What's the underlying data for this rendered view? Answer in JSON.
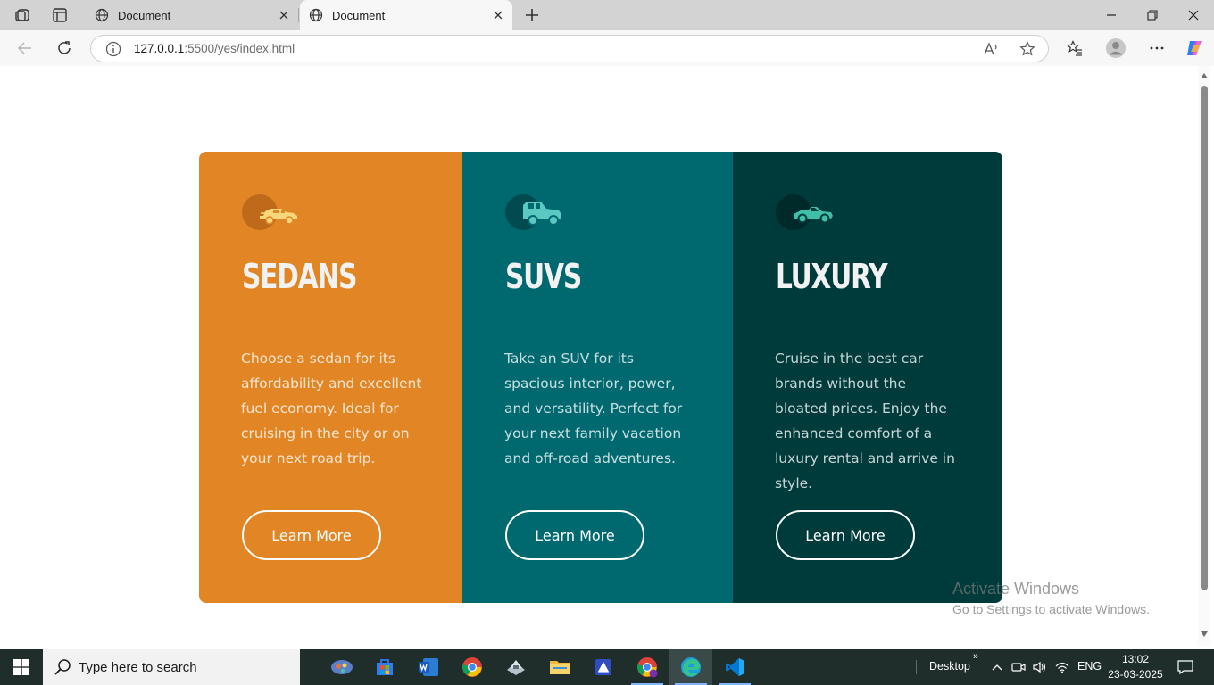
{
  "browser": {
    "tabs": [
      {
        "title": "Document",
        "active": false
      },
      {
        "title": "Document",
        "active": true
      }
    ],
    "address": {
      "host": "127.0.0.1",
      "path": ":5500/yes/index.html"
    }
  },
  "cards": [
    {
      "id": "sedans",
      "title": "SEDANS",
      "icon": "sedan-car-icon",
      "text": "Choose a sedan for its affordability and excellent fuel economy. Ideal for cruising in the city or on your next road trip.",
      "button": "Learn More",
      "color": "#e28625"
    },
    {
      "id": "suvs",
      "title": "SUVS",
      "icon": "suv-car-icon",
      "text": "Take an SUV for its spacious interior, power, and versatility. Perfect for your next family vacation and off-road adventures.",
      "button": "Learn More",
      "color": "#006970"
    },
    {
      "id": "luxury",
      "title": "LUXURY",
      "icon": "luxury-car-icon",
      "text": "Cruise in the best car brands without the bloated prices. Enjoy the enhanced comfort of a luxury rental and arrive in style.",
      "button": "Learn More",
      "color": "#003b3c"
    }
  ],
  "watermark": {
    "line1": "Activate Windows",
    "line2": "Go to Settings to activate Windows."
  },
  "taskbar": {
    "search_placeholder": "Type here to search",
    "desktop_label": "Desktop",
    "language": "ENG",
    "time": "13:02",
    "date": "23-03-2025"
  }
}
